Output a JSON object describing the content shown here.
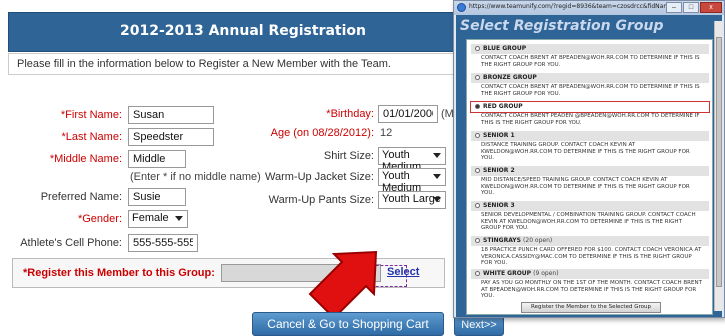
{
  "page": {
    "title": "2012-2013 Annual Registration",
    "instructions": "Please fill in the information below to Register a New Member with the Team."
  },
  "form": {
    "first_name_label": "*First Name:",
    "first_name_value": "Susan",
    "last_name_label": "*Last Name:",
    "last_name_value": "Speedster",
    "middle_name_label": "*Middle Name:",
    "middle_name_value": "Middle",
    "middle_name_hint": "(Enter * if no middle name)",
    "preferred_name_label": "Preferred Name:",
    "preferred_name_value": "Susie",
    "gender_label": "*Gender:",
    "gender_value": "Female",
    "cell_label": "Athlete's Cell Phone:",
    "cell_value": "555-555-5555",
    "birthday_label": "*Birthday:",
    "birthday_value": "01/01/2000",
    "birthday_hint": "(MM/",
    "age_label": "Age (on 08/28/2012):",
    "age_value": "12",
    "shirt_label": "Shirt Size:",
    "shirt_value": "Youth Medium",
    "jacket_label": "Warm-Up Jacket Size:",
    "jacket_value": "Youth Medium",
    "pants_label": "Warm-Up Pants Size:",
    "pants_value": "Youth Large",
    "group_label": "*Register this Member to this Group:",
    "group_value": "",
    "group_link": "Select"
  },
  "buttons": {
    "cancel": "Cancel & Go to Shopping Cart",
    "next": "Next>>"
  },
  "popup": {
    "url": "https://www.teamunify.com/?regid=8936&team=czosdrcc&fidName...",
    "minimize": "–",
    "maximize": "□",
    "close": "x",
    "heading": "Select Registration Group",
    "groups": [
      {
        "name": "BLUE GROUP",
        "open": "",
        "selected": false,
        "desc": "CONTACT COACH BRENT AT BPEADEN@WOH.RR.COM TO DETERMINE IF THIS IS THE RIGHT GROUP FOR YOU."
      },
      {
        "name": "BRONZE GROUP",
        "open": "",
        "selected": false,
        "desc": "CONTACT COACH BRENT AT BPEADEN@WOH.RR.COM TO DETERMINE IF THIS IS THE RIGHT GROUP FOR YOU."
      },
      {
        "name": "RED GROUP",
        "open": "",
        "selected": true,
        "desc": "CONTACT COACH BRENT PEADEN @BPEADEN@WOH.RR.COM TO DETERMINE IF THIS IS THE RIGHT GROUP FOR YOU."
      },
      {
        "name": "SENIOR 1",
        "open": "",
        "selected": false,
        "desc": "DISTANCE TRAINING GROUP. CONTACT COACH KEVIN AT KWELDON@WOH.RR.COM TO DETERMINE IF THIS IS THE RIGHT GROUP FOR YOU."
      },
      {
        "name": "SENIOR 2",
        "open": "",
        "selected": false,
        "desc": "MID DISTANCE/SPEED TRAINING GROUP. CONTACT COACH KEVIN AT KWELDON@WOH.RR.COM TO DETERMINE IF THIS IS THE RIGHT GROUP FOR YOU."
      },
      {
        "name": "SENIOR 3",
        "open": "",
        "selected": false,
        "desc": "SENIOR DEVELOPMENTAL / COMBINATION TRAINING GROUP. CONTACT COACH KEVIN AT KWELDON@WOH.RR.COM TO DETERMINE IF THIS IS THE RIGHT GROUP FOR YOU."
      },
      {
        "name": "STINGRAYS",
        "open": "(20 open)",
        "selected": false,
        "desc": "18 PRACTICE PUNCH CARD OFFERED FOR $100. CONTACT COACH VERONICA AT VERONICA.CASSIDY@MAC.COM TO DETERMINE IF THIS IS THE RIGHT GROUP FOR YOU."
      },
      {
        "name": "WHITE GROUP",
        "open": "(9 open)",
        "selected": false,
        "desc": "PAY AS YOU GO MONTHLY ON THE 1ST OF THE MONTH. CONTACT COACH BRENT AT BPEADEN@WOH.RR.COM TO DETERMINE IF THIS IS THE RIGHT GROUP FOR YOU."
      }
    ],
    "register_button": "Register the Member to the Selected Group"
  },
  "colors": {
    "header_blue": "#2f6496",
    "required_red": "#cc0000",
    "arrow_red": "#e01010",
    "link_blue": "#2233aa"
  }
}
